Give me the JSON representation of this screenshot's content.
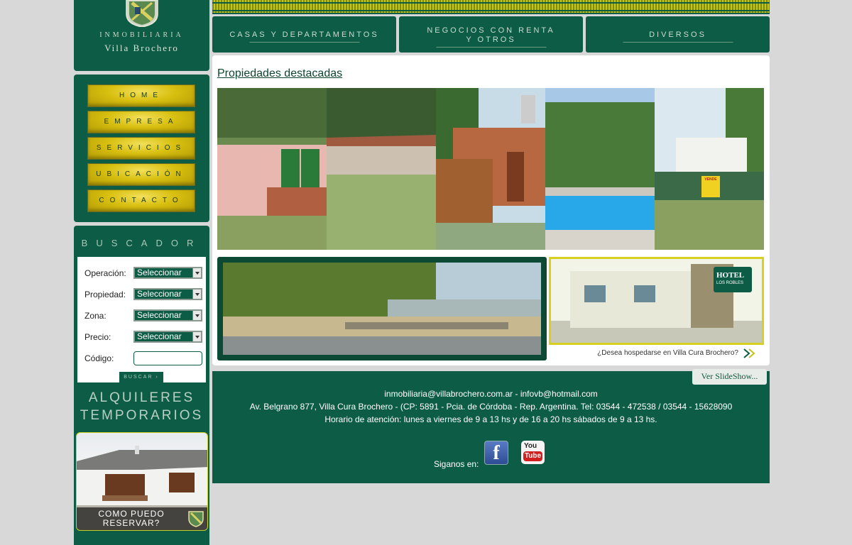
{
  "logo": {
    "line1": "INMOBILIARIA",
    "line2": "Villa Brochero"
  },
  "menu": [
    {
      "label": "HOME"
    },
    {
      "label": "EMPRESA"
    },
    {
      "label": "SERVICIOS"
    },
    {
      "label": "UBICACIÓN"
    },
    {
      "label": "CONTACTO"
    }
  ],
  "search": {
    "title": "BUSCADOR",
    "fields": [
      {
        "label": "Operación:",
        "value": "Seleccionar"
      },
      {
        "label": "Propiedad:",
        "value": "Seleccionar"
      },
      {
        "label": "Zona:",
        "value": "Seleccionar"
      },
      {
        "label": "Precio:",
        "value": "Seleccionar"
      }
    ],
    "code_label": "Código:",
    "code_value": "",
    "button": "BUSCAR"
  },
  "rentals": {
    "title_line1": "ALQUILERES",
    "title_line2": "TEMPORARIOS",
    "caption_line1": "COMO PUEDO",
    "caption_line2": "RESERVAR?"
  },
  "categories": [
    {
      "line1": "CASAS Y DEPARTAMENTOS",
      "line2": ""
    },
    {
      "line1": "NEGOCIOS CON RENTA",
      "line2": "Y OTROS"
    },
    {
      "line1": "DIVERSOS",
      "line2": ""
    }
  ],
  "featured": {
    "title": "Propiedades destacadas"
  },
  "hotel_banner": {
    "sign": "HOTEL",
    "sign_sub": "LOS ROBLES",
    "question": "¿Desea hospedarse en Villa Cura Brochero?",
    "sale_sign": "VENDE"
  },
  "slideshow_link": "Ver SlideShow...",
  "footer": {
    "emails": "inmobiliaria@villabrochero.com.ar - infovb@hotmail.com",
    "address": "Av. Belgrano 877, Villa Cura Brochero - (CP: 5891 - Pcia. de Córdoba - Rep. Argentina. Tel: 03544 - 472538 / 03544 - 15628090",
    "hours": "Horario de atención: lunes a viernes de 9 a 13 hs y de 16 a 20 hs sábados de 9 a 13 hs.",
    "follow": "Siganos en:",
    "facebook": "f",
    "youtube_top": "You",
    "youtube_bottom": "Tube"
  },
  "colors": {
    "brand_green": "#0d5c45",
    "menu_gold": "#d8bf10",
    "background": "#d8d8d8"
  }
}
